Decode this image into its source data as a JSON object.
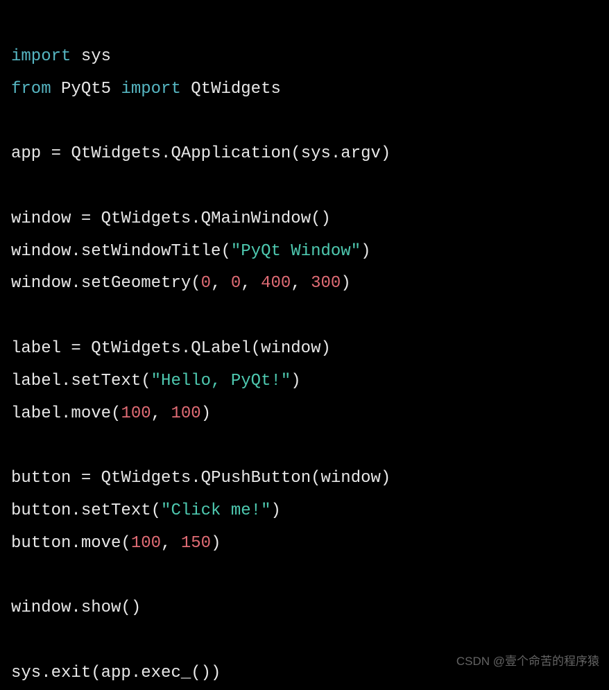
{
  "code": {
    "line1": {
      "import": "import",
      "sys": "sys"
    },
    "line2": {
      "from": "from",
      "pyqt5": "PyQt5",
      "import": "import",
      "qtwidgets": "QtWidgets"
    },
    "line4": {
      "app": "app",
      "eq": " = ",
      "call": "QtWidgets.QApplication(sys.argv)"
    },
    "line6": {
      "window": "window",
      "eq": " = ",
      "call": "QtWidgets.QMainWindow()"
    },
    "line7": {
      "prefix": "window.setWindowTitle(",
      "str": "\"PyQt Window\"",
      "suffix": ")"
    },
    "line8": {
      "prefix": "window.setGeometry(",
      "n1": "0",
      "c1": ", ",
      "n2": "0",
      "c2": ", ",
      "n3": "400",
      "c3": ", ",
      "n4": "300",
      "suffix": ")"
    },
    "line10": {
      "label": "label",
      "eq": " = ",
      "call": "QtWidgets.QLabel(window)"
    },
    "line11": {
      "prefix": "label.setText(",
      "str": "\"Hello, PyQt!\"",
      "suffix": ")"
    },
    "line12": {
      "prefix": "label.move(",
      "n1": "100",
      "c1": ", ",
      "n2": "100",
      "suffix": ")"
    },
    "line14": {
      "button": "button",
      "eq": " = ",
      "call": "QtWidgets.QPushButton(window)"
    },
    "line15": {
      "prefix": "button.setText(",
      "str": "\"Click me!\"",
      "suffix": ")"
    },
    "line16": {
      "prefix": "button.move(",
      "n1": "100",
      "c1": ", ",
      "n2": "150",
      "suffix": ")"
    },
    "line18": {
      "call": "window.show()"
    },
    "line20": {
      "call": "sys.exit(app.exec_())"
    }
  },
  "watermark": "CSDN @壹个命苦的程序猿"
}
